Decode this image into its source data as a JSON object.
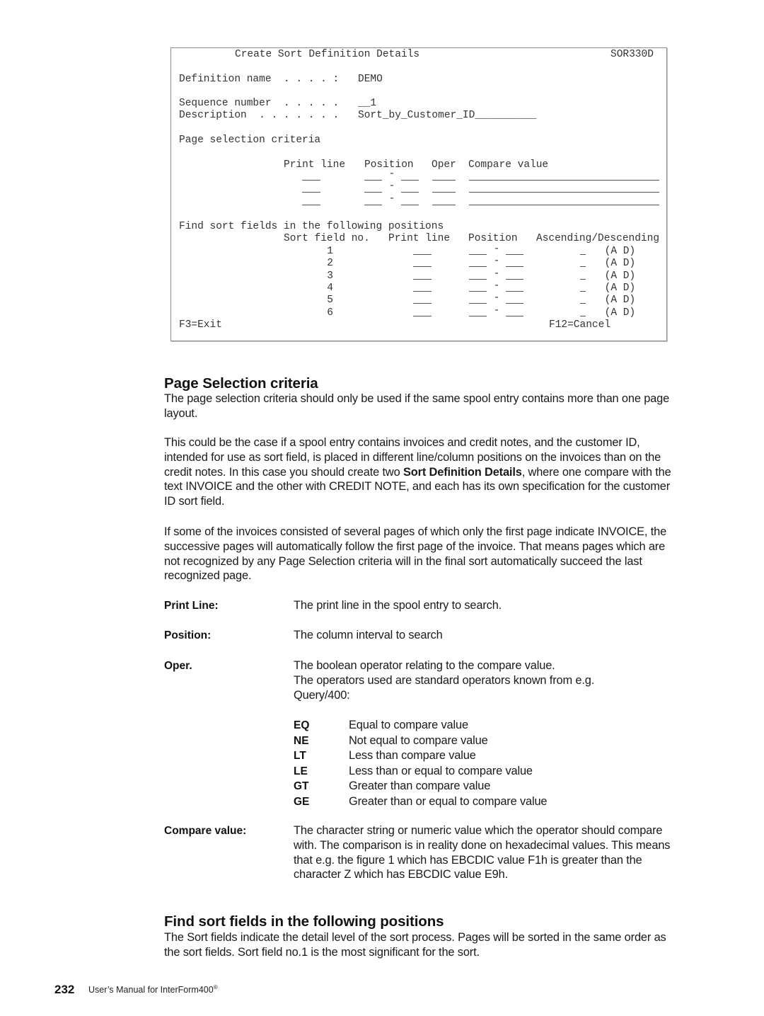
{
  "screen": {
    "title": "Create Sort Definition Details",
    "screen_id": "SOR330D",
    "fields": {
      "definition_name_label": "Definition name  . . . . :",
      "definition_name_value": "DEMO",
      "sequence_number_label": "Sequence number  . . . . .",
      "sequence_number_value": "__1",
      "description_label": "Description  . . . . . . .",
      "description_value": "Sort_by_Customer_ID__________"
    },
    "page_selection": {
      "section_label": "Page selection criteria",
      "headers": {
        "print_line": "Print line",
        "position": "Position",
        "oper": "Oper",
        "compare_value": "Compare value"
      },
      "rows": [
        {
          "print_line": "",
          "position_from": "",
          "position_to": "",
          "oper": "",
          "compare_value": ""
        },
        {
          "print_line": "",
          "position_from": "",
          "position_to": "",
          "oper": "",
          "compare_value": ""
        },
        {
          "print_line": "",
          "position_from": "",
          "position_to": "",
          "oper": "",
          "compare_value": ""
        }
      ],
      "separator": "-"
    },
    "sort_fields": {
      "section_label": "Find sort fields in the following positions",
      "headers": {
        "sort_field_no": "Sort field no.",
        "print_line": "Print line",
        "position": "Position",
        "asc_desc": "Ascending/Descending"
      },
      "rows": [
        {
          "no": "1",
          "print_line": "",
          "position_from": "",
          "position_to": "",
          "asc_desc": "",
          "options": "(A D)"
        },
        {
          "no": "2",
          "print_line": "",
          "position_from": "",
          "position_to": "",
          "asc_desc": "",
          "options": "(A D)"
        },
        {
          "no": "3",
          "print_line": "",
          "position_from": "",
          "position_to": "",
          "asc_desc": "",
          "options": "(A D)"
        },
        {
          "no": "4",
          "print_line": "",
          "position_from": "",
          "position_to": "",
          "asc_desc": "",
          "options": "(A D)"
        },
        {
          "no": "5",
          "print_line": "",
          "position_from": "",
          "position_to": "",
          "asc_desc": "",
          "options": "(A D)"
        },
        {
          "no": "6",
          "print_line": "",
          "position_from": "",
          "position_to": "",
          "asc_desc": "",
          "options": "(A D)"
        }
      ],
      "separator": "-"
    },
    "function_keys": {
      "exit": "F3=Exit",
      "cancel": "F12=Cancel"
    }
  },
  "doc": {
    "section1_heading": "Page Selection criteria",
    "p1": "The page selection criteria should only be used if the same spool entry contains more than one page layout.",
    "p2_part1": "This could be the case if a spool entry contains invoices and credit notes, and the customer ID, intended for use as sort field, is placed in different line/column positions on the invoices than on the credit notes. In this case you should create two ",
    "p2_bold": "Sort Definition Details",
    "p2_part2": ", where one compare with the text INVOICE and the other with CREDIT NOTE, and each has its own specification for the customer ID sort field.",
    "p3": "If some of the invoices consisted of several pages of which only the first page indicate INVOICE, the successive pages will automatically follow the first page of the invoice. That means pages which are not recognized by any Page Selection criteria will in the final sort automatically succeed the last recognized page.",
    "definitions": [
      {
        "term": "Print Line:",
        "desc": "The print line in the spool entry to search."
      },
      {
        "term": "Position:",
        "desc": "The column interval to search"
      },
      {
        "term": "Oper.",
        "desc": "The boolean operator relating to the compare value.\nThe operators used are standard operators known from e.g. Query/400:"
      },
      {
        "term": "Compare value:",
        "desc": "The character string or numeric value which the operator should compare with. The comparison is in reality done on hexadecimal values. This means that e.g. the figure 1 which has EBCDIC value F1h is greater than the character Z which has EBCDIC value E9h."
      }
    ],
    "operators": [
      {
        "code": "EQ",
        "desc": "Equal to compare value"
      },
      {
        "code": "NE",
        "desc": "Not equal to compare value"
      },
      {
        "code": "LT",
        "desc": "Less than compare value"
      },
      {
        "code": "LE",
        "desc": "Less than or equal to compare value"
      },
      {
        "code": "GT",
        "desc": "Greater than compare value"
      },
      {
        "code": "GE",
        "desc": "Greater than or equal to compare value"
      }
    ],
    "section2_heading": "Find sort fields in the following positions",
    "p4": "The Sort fields indicate the detail level of the sort process. Pages will be sorted in the same order as the sort fields. Sort field no.1 is the most significant for the sort."
  },
  "footer": {
    "page_number": "232",
    "manual_title": "User’s Manual for InterForm400",
    "trademark": "®"
  }
}
